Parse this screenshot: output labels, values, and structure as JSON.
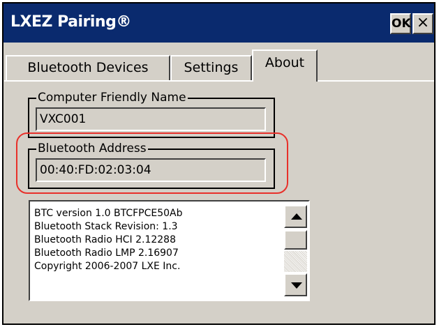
{
  "window": {
    "title": "LXEZ Pairing®",
    "ok_label": "OK",
    "close_label": "×"
  },
  "tabs": [
    {
      "label": "Bluetooth Devices",
      "selected": false
    },
    {
      "label": "Settings",
      "selected": false
    },
    {
      "label": "About",
      "selected": true
    }
  ],
  "computer_name": {
    "label": "Computer Friendly Name",
    "value": "VXC001"
  },
  "bluetooth_address": {
    "label": "Bluetooth Address",
    "value": "00:40:FD:02:03:04"
  },
  "info": {
    "lines": [
      "BTC version 1.0 BTCFPCE50Ab",
      "Bluetooth Stack Revision: 1.3",
      "Bluetooth Radio HCI 2.12288",
      "Bluetooth Radio LMP 2.16907",
      "Copyright 2006-2007 LXE Inc."
    ]
  },
  "icons": {
    "scroll_up": "arrow-up-icon",
    "scroll_down": "arrow-down-icon",
    "close": "close-icon"
  },
  "colors": {
    "titlebar": "#0a2a6e",
    "highlight": "#e8302a",
    "window": "#d4d0c8"
  }
}
